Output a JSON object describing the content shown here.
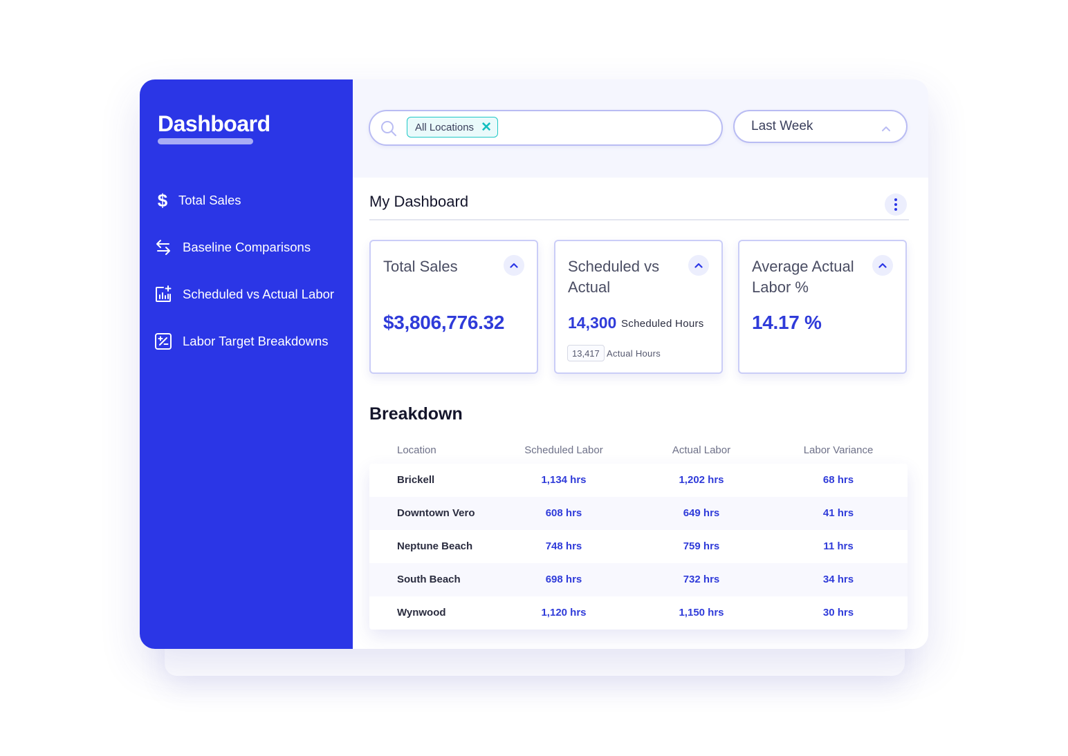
{
  "sidebar": {
    "title": "Dashboard",
    "items": [
      {
        "label": "Total Sales",
        "icon": "dollar-icon"
      },
      {
        "label": "Baseline Comparisons",
        "icon": "swap-arrows-icon"
      },
      {
        "label": "Scheduled vs Actual Labor",
        "icon": "bar-chart-plus-icon"
      },
      {
        "label": "Labor Target Breakdowns",
        "icon": "percent-square-icon"
      }
    ]
  },
  "filters": {
    "search_placeholder": "",
    "chip_label": "All Locations",
    "period_label": "Last Week"
  },
  "dashboard": {
    "title": "My Dashboard",
    "cards": [
      {
        "title": "Total Sales",
        "value": "$3,806,776.32"
      },
      {
        "title": "Scheduled vs Actual",
        "value": "14,300",
        "value_label": "Scheduled Hours",
        "sub_value": "13,417",
        "sub_label": "Actual Hours"
      },
      {
        "title": "Average Actual Labor %",
        "value": "14.17 %"
      }
    ]
  },
  "breakdown": {
    "title": "Breakdown",
    "columns": [
      "Location",
      "Scheduled Labor",
      "Actual Labor",
      "Labor Variance"
    ],
    "rows": [
      [
        "Brickell",
        "1,134 hrs",
        "1,202 hrs",
        "68 hrs"
      ],
      [
        "Downtown Vero",
        "608 hrs",
        "649 hrs",
        "41 hrs"
      ],
      [
        "Neptune Beach",
        "748 hrs",
        "759 hrs",
        "11 hrs"
      ],
      [
        "South Beach",
        "698 hrs",
        "732 hrs",
        "34 hrs"
      ],
      [
        "Wynwood",
        "1,120 hrs",
        "1,150 hrs",
        "30 hrs"
      ]
    ]
  },
  "colors": {
    "brand": "#2b36e6",
    "accent_value": "#2f3bd9",
    "chip_border": "#1fc8c6"
  }
}
